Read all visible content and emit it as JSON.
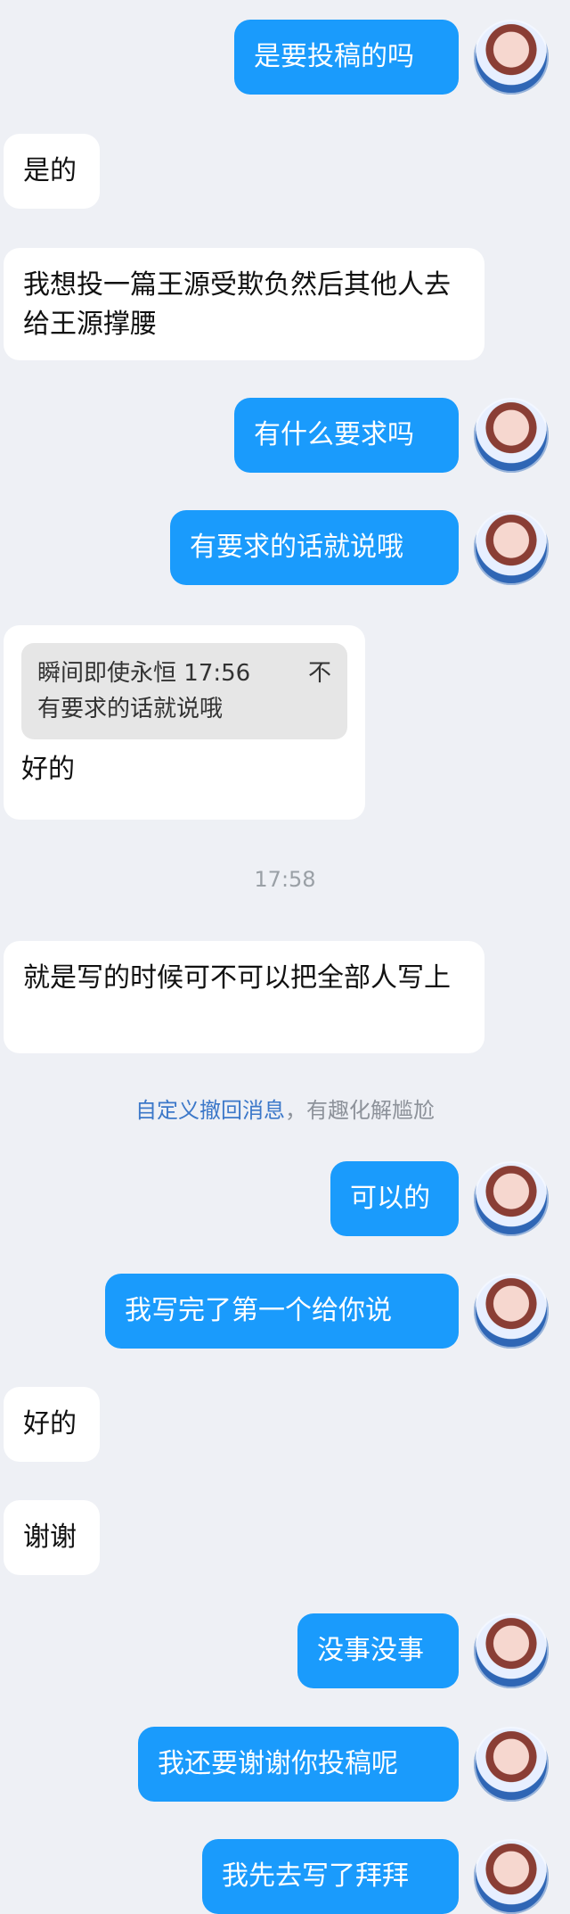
{
  "messages": [
    {
      "type": "out",
      "text": "是要投稿的吗"
    },
    {
      "type": "in",
      "text": "是的"
    },
    {
      "type": "in",
      "text": "我想投一篇王源受欺负然后其他人去给王源撑腰"
    },
    {
      "type": "out",
      "text": "有什么要求吗"
    },
    {
      "type": "out",
      "text": "有要求的话就说哦"
    },
    {
      "type": "in_reply",
      "quote_name": "瞬间即使永恒",
      "quote_time": "17:56",
      "quote_icon": "不",
      "quote_text": "有要求的话就说哦",
      "text": "好的"
    },
    {
      "type": "time",
      "text": "17:58"
    },
    {
      "type": "in",
      "text": "就是写的时候可不可以把全部人写上"
    },
    {
      "type": "system",
      "link": "自定义撤回消息",
      "text": "，有趣化解尴尬"
    },
    {
      "type": "out",
      "text": "可以的"
    },
    {
      "type": "out",
      "text": "我写完了第一个给你说"
    },
    {
      "type": "in",
      "text": "好的"
    },
    {
      "type": "in",
      "text": "谢谢"
    },
    {
      "type": "out",
      "text": "没事没事"
    },
    {
      "type": "out",
      "text": "我还要谢谢你投稿呢"
    },
    {
      "type": "out",
      "text": "我先去写了拜拜"
    }
  ]
}
